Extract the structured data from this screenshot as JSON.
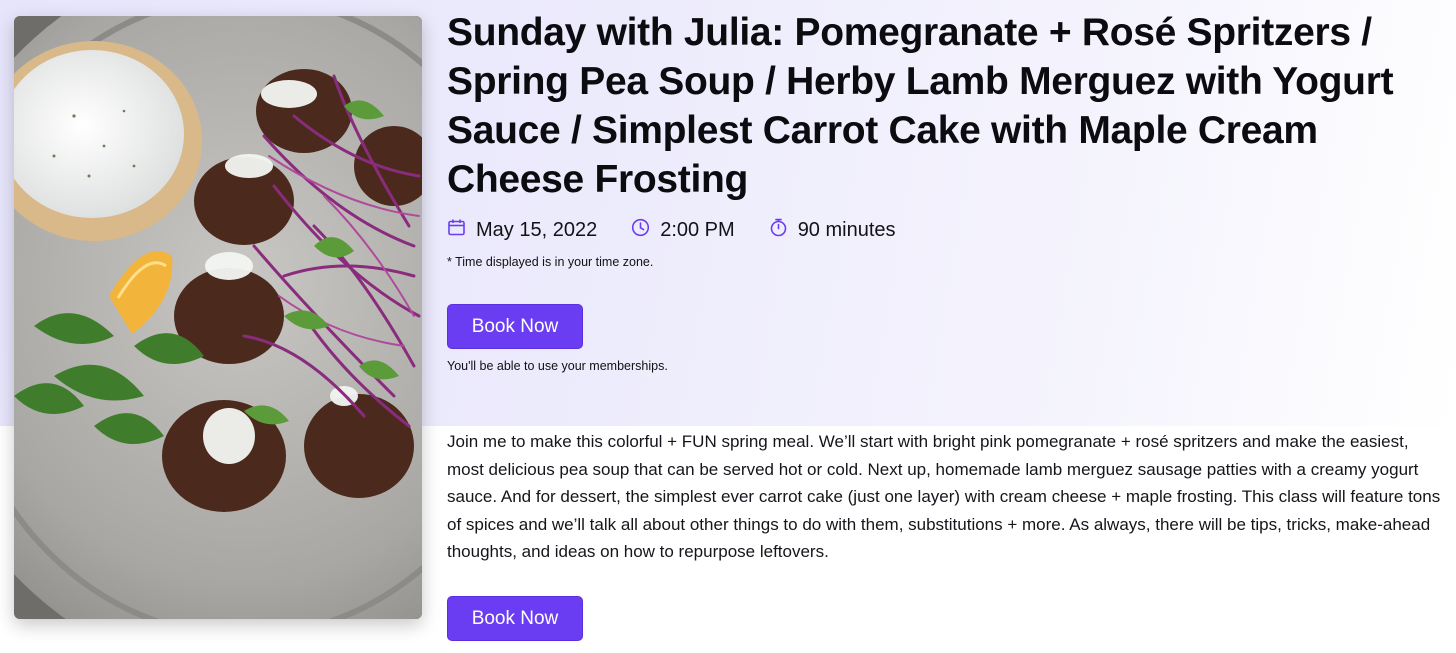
{
  "event": {
    "title": "Sunday with Julia: Pomegranate + Rosé Spritzers / Spring Pea Soup / Herby Lamb Merguez with Yogurt Sauce / Simplest Carrot Cake with Maple Cream Cheese Frosting",
    "date": "May 15, 2022",
    "time": "2:00 PM",
    "duration": "90 minutes",
    "timezone_note": "* Time displayed is in your time zone.",
    "membership_note": "You'll be able to use your memberships.",
    "description": "Join me to make this colorful + FUN spring meal. We’ll start with bright pink pomegranate + rosé spritzers and make the easiest, most delicious pea soup that can be served hot or cold. Next up, homemade lamb merguez sausage patties with a creamy yogurt sauce. And for dessert, the simplest ever carrot cake (just one layer) with cream cheese + maple frosting. This class will feature tons of spices and we’ll talk all about other things to do with them, substitutions + more. As always, there will be tips, tricks, make-ahead thoughts, and ideas on how to repurpose leftovers."
  },
  "buttons": {
    "book_now_top": "Book Now",
    "book_now_bottom": "Book Now"
  },
  "icons": {
    "date": "calendar-icon",
    "time": "clock-icon",
    "duration": "stopwatch-icon"
  },
  "colors": {
    "accent": "#6a3df2",
    "icon": "#6a3df2",
    "background_tint": "#ecebfc"
  }
}
